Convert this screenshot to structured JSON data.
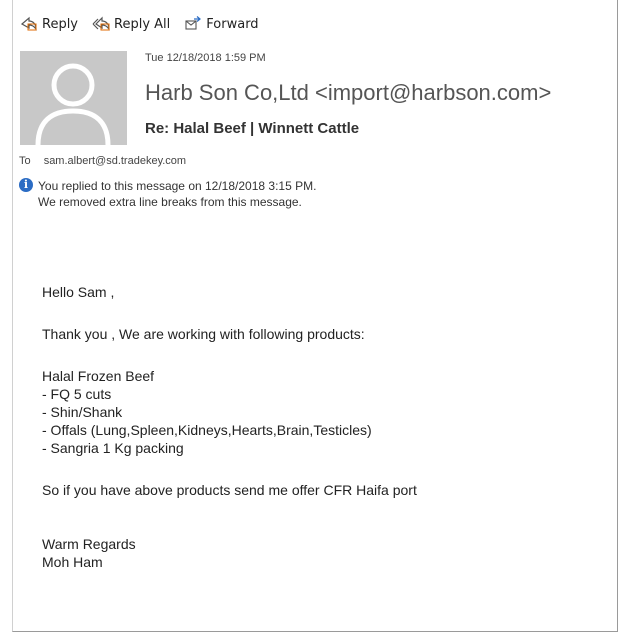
{
  "toolbar": {
    "reply_label": "Reply",
    "reply_all_label": "Reply All",
    "forward_label": "Forward"
  },
  "message": {
    "date": "Tue 12/18/2018 1:59 PM",
    "sender": "Harb Son Co,Ltd <import@harbson.com>",
    "subject": "Re: Halal Beef | Winnett Cattle",
    "to_label": "To",
    "to": "sam.albert@sd.tradekey.com",
    "info_line1": "You replied to this message on 12/18/2018 3:15 PM.",
    "info_line2": "We removed extra line breaks from this message."
  },
  "body": {
    "greeting": "Hello Sam ,",
    "intro": "Thank you , We are working with following products:",
    "product_heading": "Halal Frozen Beef",
    "items": [
      "- FQ 5 cuts",
      "- Shin/Shank",
      "- Offals (Lung,Spleen,Kidneys,Hearts,Brain,Testicles)",
      "- Sangria 1 Kg packing"
    ],
    "request": "So if you have above products send me offer CFR Haifa port",
    "closing": "Warm Regards",
    "signature": "Moh Ham"
  }
}
